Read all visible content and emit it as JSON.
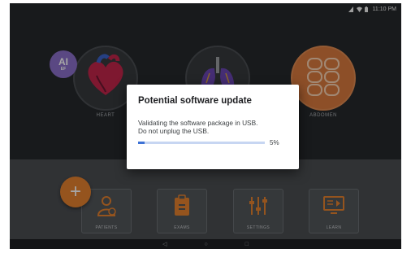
{
  "status_bar": {
    "time": "11:10 PM"
  },
  "categories": [
    {
      "label": "HEART"
    },
    {
      "label": ""
    },
    {
      "label": "ABDOMEN"
    }
  ],
  "ai_badge": {
    "text": "AI",
    "subtext": "EF"
  },
  "bottom_buttons": [
    {
      "label": "PATIENTS",
      "icon": "patient-icon"
    },
    {
      "label": "EXAMS",
      "icon": "clipboard-icon"
    },
    {
      "label": "SETTINGS",
      "icon": "sliders-icon"
    },
    {
      "label": "LEARN",
      "icon": "learn-icon"
    }
  ],
  "fab": {
    "label": "+"
  },
  "nav": {
    "back": "◁",
    "home": "○",
    "recents": "□"
  },
  "dialog": {
    "title": "Potential software update",
    "message_line1": "Validating the software package in USB.",
    "message_line2": "Do not unplug the USB.",
    "progress_percent": 5,
    "progress_label": "5%"
  },
  "colors": {
    "accent": "#e5812e",
    "progress": "#3d72d6",
    "badge": "#8b6fc9"
  }
}
